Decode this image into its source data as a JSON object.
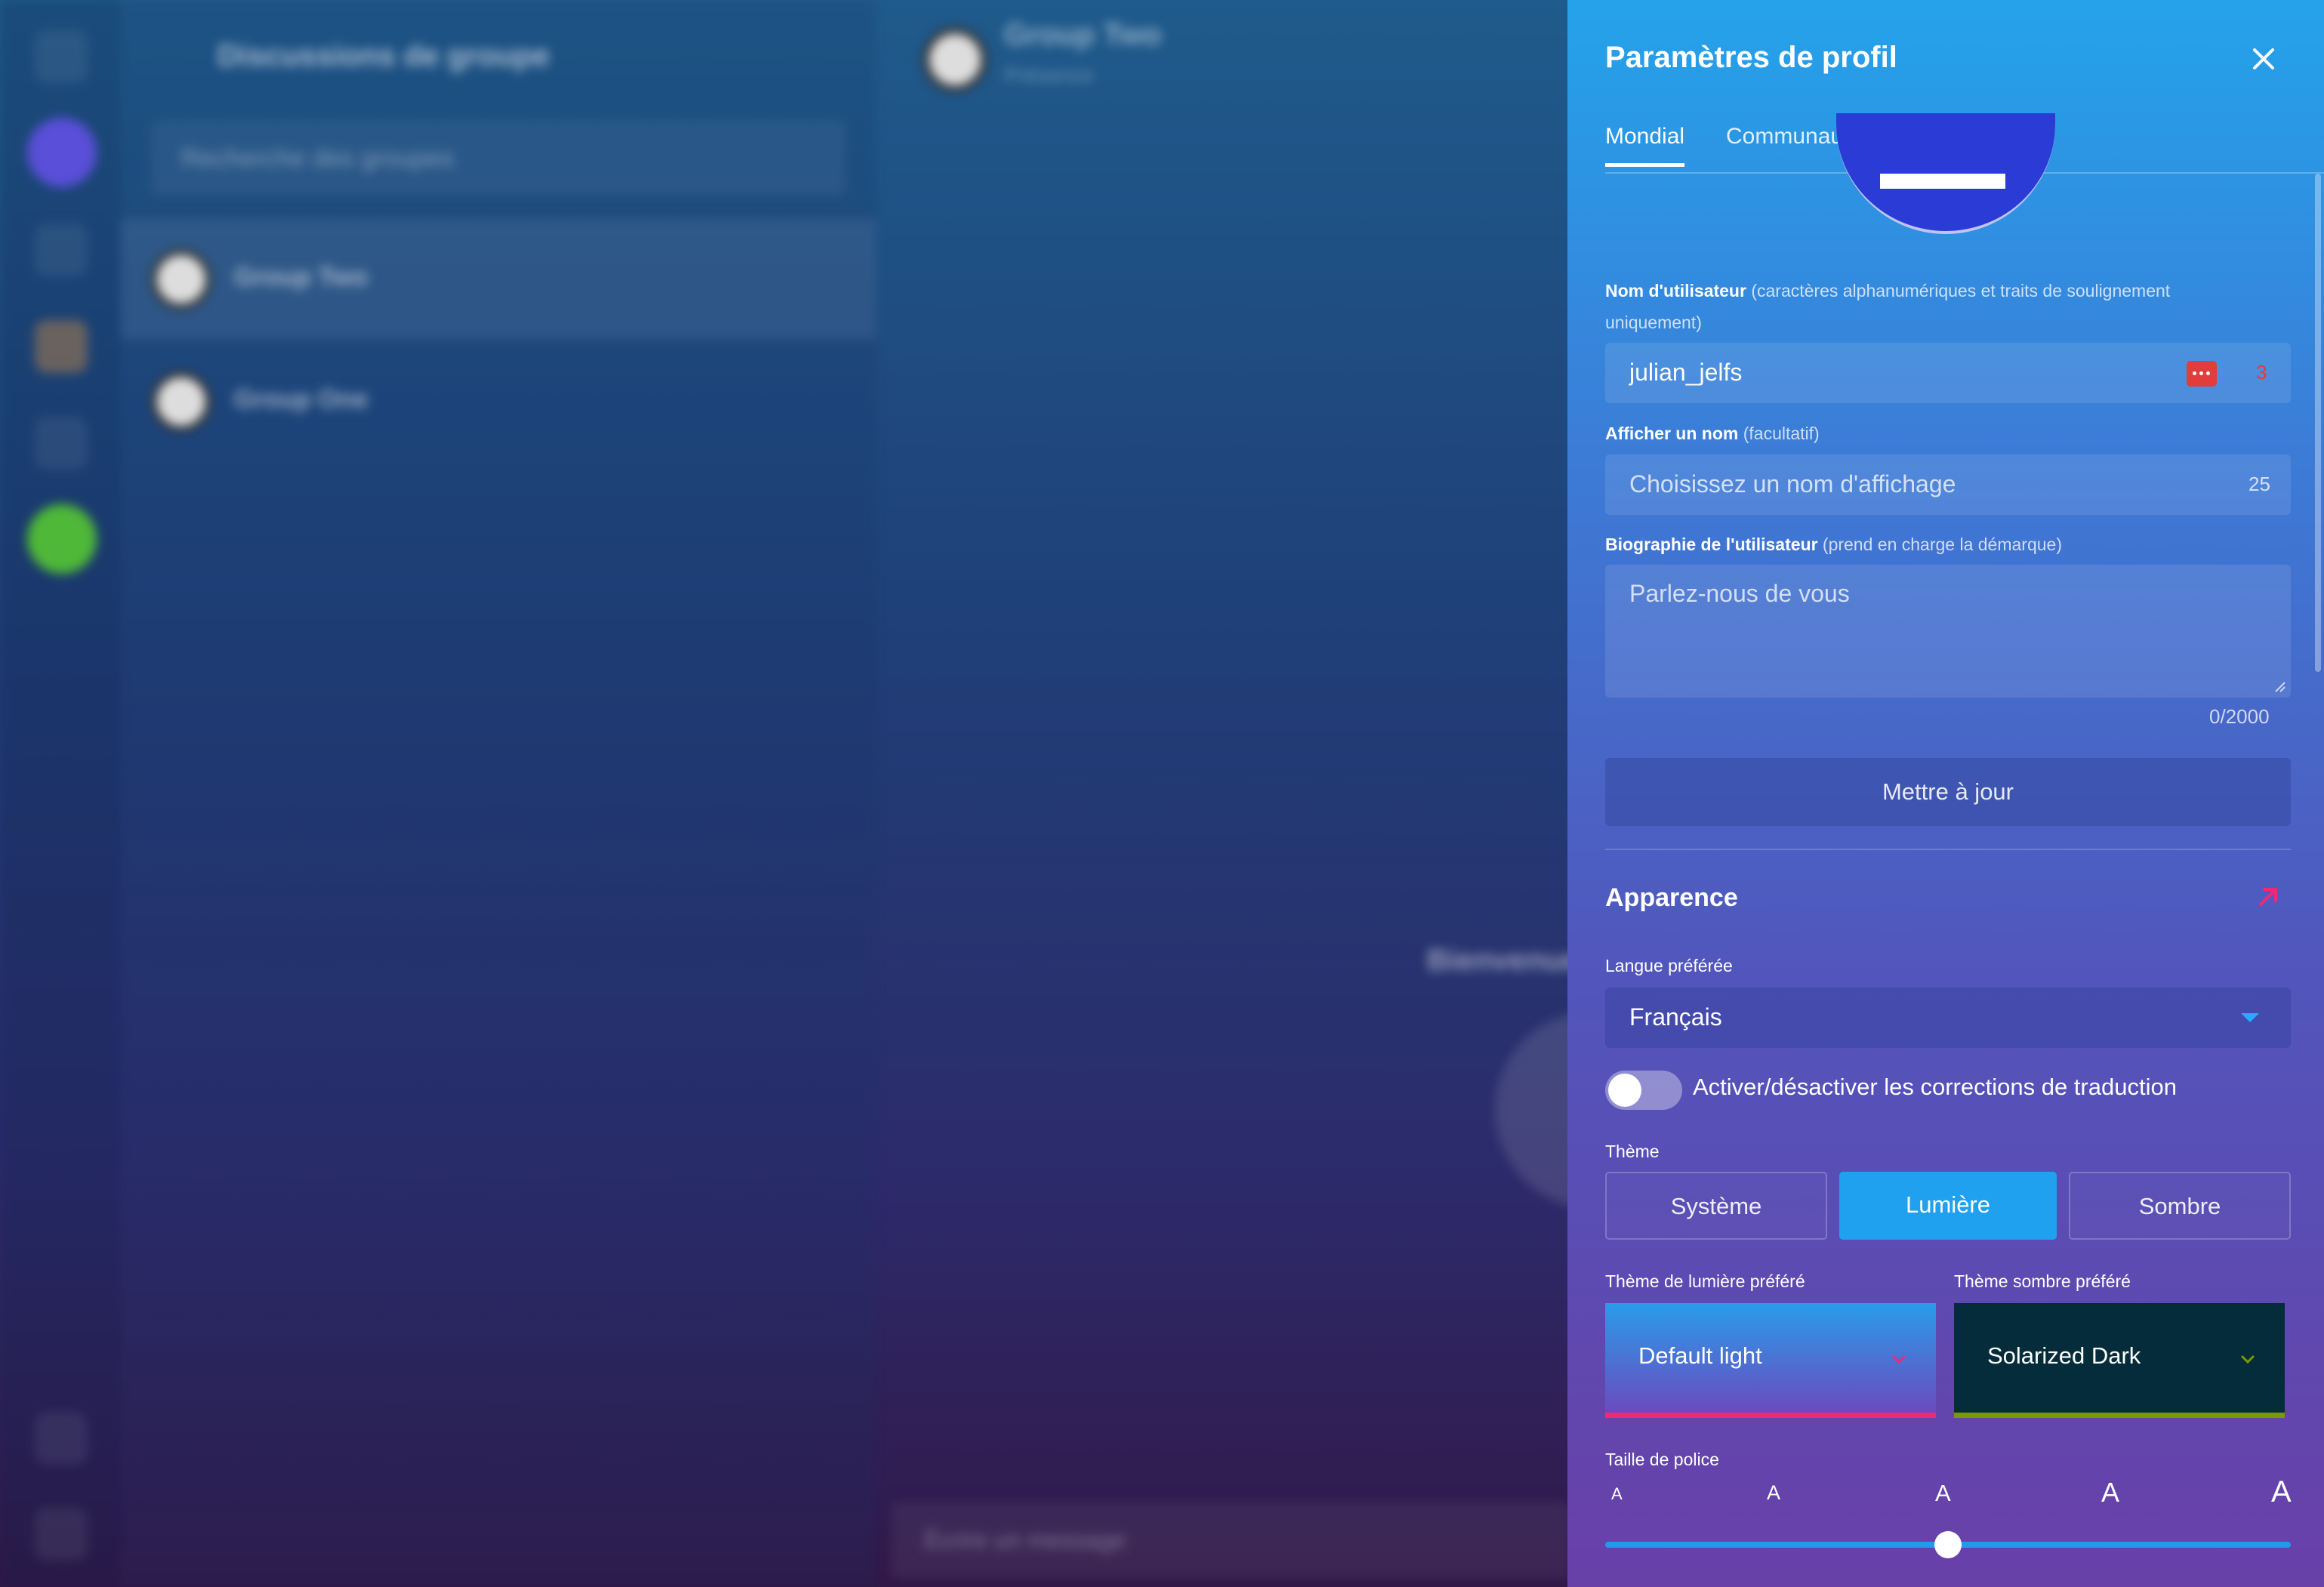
{
  "background": {
    "list_title": "Discussions de groupe",
    "search_placeholder": "Recherche des groupes",
    "groups": [
      {
        "name": "Group Two"
      },
      {
        "name": "Group One"
      }
    ],
    "chat_title": "Group Two",
    "chat_status": "Présence",
    "welcome": "Bienvenue",
    "compose_placeholder": "Écrire un message"
  },
  "panel": {
    "title": "Paramètres de profil",
    "tabs": [
      {
        "label": "Mondial",
        "active": true
      },
      {
        "label": "Communauté",
        "active": false
      }
    ],
    "username": {
      "label": "Nom d'utilisateur",
      "hint": "(caractères alphanumériques et traits de soulignement",
      "hint_line2": "uniquement)",
      "value": "julian_jelfs",
      "counter": "3"
    },
    "display_name": {
      "label": "Afficher un nom",
      "hint": "(facultatif)",
      "placeholder": "Choisissez un nom d'affichage",
      "counter": "25"
    },
    "bio": {
      "label": "Biographie de l'utilisateur",
      "hint": "(prend en charge la démarque)",
      "placeholder": "Parlez-nous de vous",
      "counter": "0/2000"
    },
    "update_button": "Mettre à jour",
    "appearance": {
      "title": "Apparence",
      "language_label": "Langue préférée",
      "language_value": "Français",
      "toggle_label": "Activer/désactiver les corrections de traduction",
      "toggle_on": false,
      "theme_label": "Thème",
      "theme_options": [
        "Système",
        "Lumière",
        "Sombre"
      ],
      "theme_selected": "Lumière",
      "light_theme_label": "Thème de lumière préféré",
      "light_theme_value": "Default light",
      "dark_theme_label": "Thème sombre préféré",
      "dark_theme_value": "Solarized Dark",
      "font_size_label": "Taille de police",
      "font_letters": [
        "A",
        "A",
        "A",
        "A",
        "A"
      ],
      "font_size_level": 0.5
    }
  },
  "colors": {
    "accent": "#1fa1ef",
    "pink": "#f0287a",
    "red_badge": "#e23c3c",
    "dark_theme_bg": "#052c3a",
    "dark_theme_accent": "#7b9a00"
  },
  "icons": {
    "close": "close-icon",
    "external": "external-link-icon",
    "password": "password-dots-icon",
    "caret": "caret-down-icon",
    "chevron": "chevron-down-icon"
  }
}
